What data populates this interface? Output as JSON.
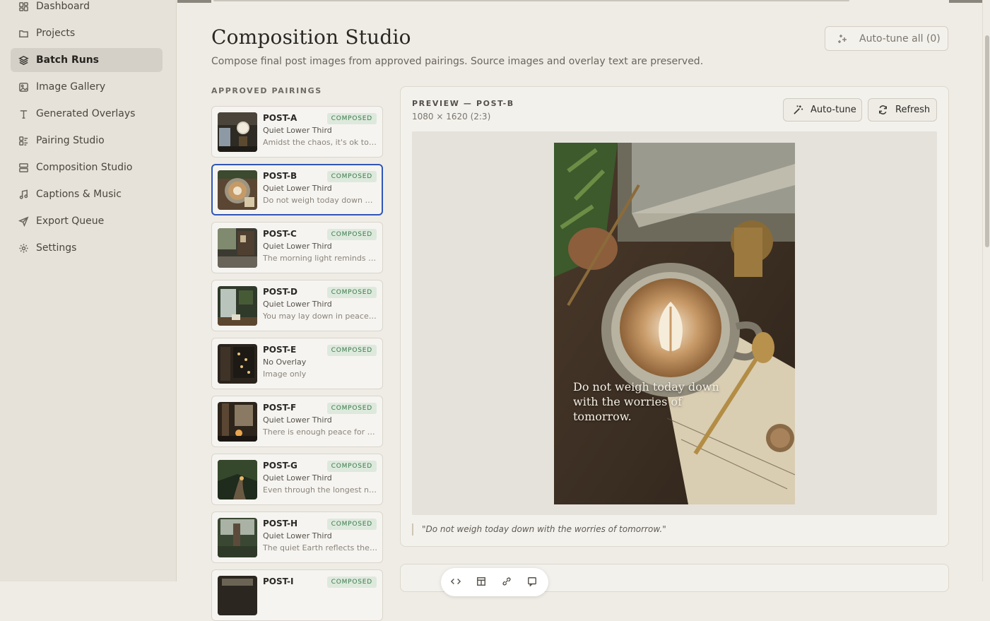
{
  "sidebar": {
    "items": [
      {
        "label": "Dashboard",
        "icon": "dashboard-icon"
      },
      {
        "label": "Projects",
        "icon": "folder-icon"
      },
      {
        "label": "Batch Runs",
        "icon": "layers-icon",
        "active": true
      },
      {
        "label": "Image Gallery",
        "icon": "image-icon"
      },
      {
        "label": "Generated Overlays",
        "icon": "type-icon"
      },
      {
        "label": "Pairing Studio",
        "icon": "pairing-icon"
      },
      {
        "label": "Composition Studio",
        "icon": "layout-icon"
      },
      {
        "label": "Captions & Music",
        "icon": "music-icon"
      },
      {
        "label": "Export Queue",
        "icon": "send-icon"
      },
      {
        "label": "Settings",
        "icon": "gear-icon"
      }
    ]
  },
  "header": {
    "title": "Composition Studio",
    "subtitle": "Compose final post images from approved pairings. Source images and overlay text are preserved.",
    "autotune_all_label": "Auto-tune all (0)"
  },
  "pairings": {
    "section_label": "APPROVED PAIRINGS",
    "items": [
      {
        "id": "POST-A",
        "status": "COMPOSED",
        "style": "Quiet Lower Third",
        "snippet": "Amidst the chaos, it's ok to s..."
      },
      {
        "id": "POST-B",
        "status": "COMPOSED",
        "style": "Quiet Lower Third",
        "snippet": "Do not weigh today down wit...",
        "selected": true
      },
      {
        "id": "POST-C",
        "status": "COMPOSED",
        "style": "Quiet Lower Third",
        "snippet": "The morning light reminds u..."
      },
      {
        "id": "POST-D",
        "status": "COMPOSED",
        "style": "Quiet Lower Third",
        "snippet": "You may lay down in peace, ..."
      },
      {
        "id": "POST-E",
        "status": "COMPOSED",
        "style": "No Overlay",
        "snippet": "Image only"
      },
      {
        "id": "POST-F",
        "status": "COMPOSED",
        "style": "Quiet Lower Third",
        "snippet": "There is enough peace for th..."
      },
      {
        "id": "POST-G",
        "status": "COMPOSED",
        "style": "Quiet Lower Third",
        "snippet": "Even through the longest nig..."
      },
      {
        "id": "POST-H",
        "status": "COMPOSED",
        "style": "Quiet Lower Third",
        "snippet": "The quiet Earth reflects the s..."
      },
      {
        "id": "POST-I",
        "status": "COMPOSED",
        "style": "",
        "snippet": ""
      }
    ]
  },
  "preview": {
    "label": "PREVIEW — POST-B",
    "dims": "1080 × 1620 (2:3)",
    "autotune_label": "Auto-tune",
    "refresh_label": "Refresh",
    "overlay_text": "Do not weigh today down with the worries of tomorrow.",
    "quote": "\"Do not weigh today down with the worries of tomorrow.\""
  },
  "colors": {
    "accent_selected": "#2f56b8",
    "badge_text": "#3b7a4c",
    "badge_bg": "#dde9dc"
  }
}
